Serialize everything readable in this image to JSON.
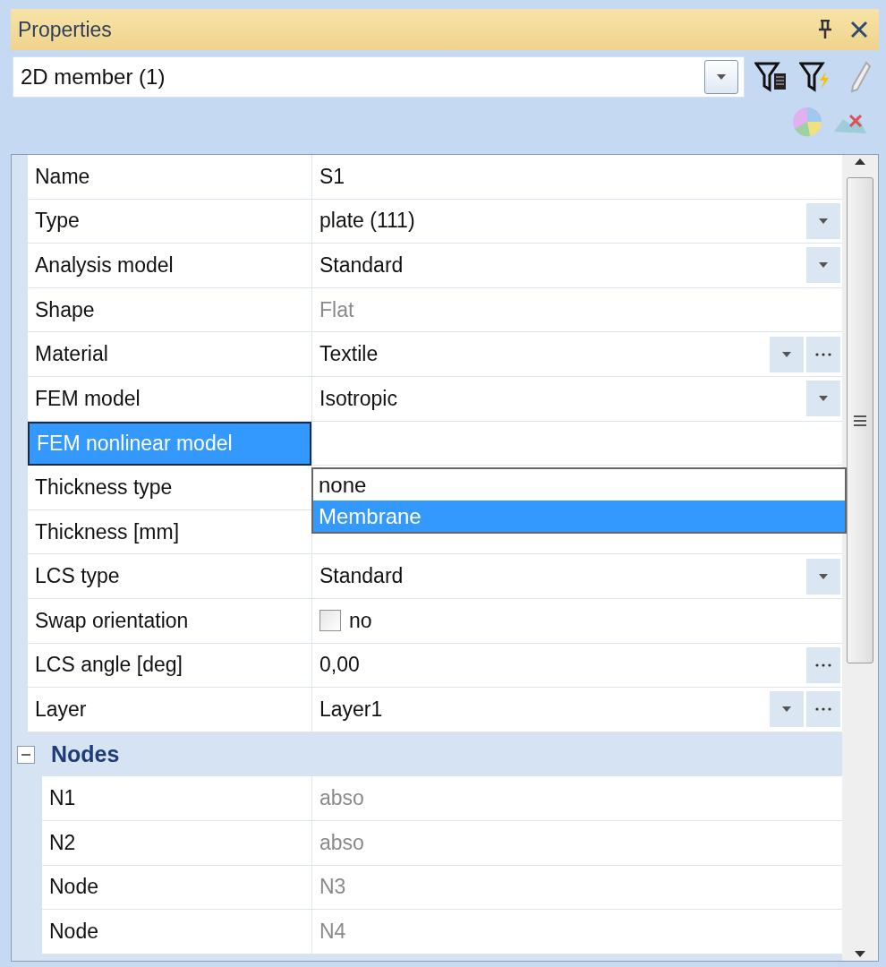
{
  "panel": {
    "title": "Properties"
  },
  "selector": {
    "value": "2D member (1)"
  },
  "properties": [
    {
      "label": "Name",
      "value": "S1",
      "kind": "text",
      "disabled": false,
      "selected": false
    },
    {
      "label": "Type",
      "value": "plate (111)",
      "kind": "dropdown",
      "disabled": false,
      "selected": false
    },
    {
      "label": "Analysis model",
      "value": "Standard",
      "kind": "dropdown",
      "disabled": false,
      "selected": false
    },
    {
      "label": "Shape",
      "value": "Flat",
      "kind": "text",
      "disabled": true,
      "selected": false
    },
    {
      "label": "Material",
      "value": "Textile",
      "kind": "combo",
      "disabled": false,
      "selected": false
    },
    {
      "label": "FEM model",
      "value": "Isotropic",
      "kind": "dropdown",
      "disabled": false,
      "selected": false
    },
    {
      "label": "FEM nonlinear model",
      "kind": "open",
      "selected": true,
      "options": [
        {
          "label": "none",
          "selected": false
        },
        {
          "label": "Membrane",
          "selected": true
        }
      ]
    },
    {
      "label": "Thickness type",
      "kind": "text",
      "selected": false
    },
    {
      "label": "Thickness [mm]",
      "kind": "text",
      "selected": false
    },
    {
      "label": "LCS type",
      "value": "Standard",
      "kind": "dropdown",
      "disabled": false,
      "selected": false
    },
    {
      "label": "Swap orientation",
      "value": "no",
      "kind": "checkbox",
      "checked": false,
      "disabled": false,
      "selected": false
    },
    {
      "label": "LCS angle [deg]",
      "value": "0,00",
      "kind": "browse",
      "disabled": false,
      "selected": false
    },
    {
      "label": "Layer",
      "value": "Layer1",
      "kind": "combo",
      "disabled": false,
      "selected": false
    }
  ],
  "group": {
    "title": "Nodes",
    "expanded": true,
    "rows": [
      {
        "label": "N1",
        "value": "abso",
        "disabled": true
      },
      {
        "label": "N2",
        "value": "abso",
        "disabled": true
      },
      {
        "label": "Node",
        "value": "N3",
        "disabled": true
      },
      {
        "label": "Node",
        "value": "N4",
        "disabled": true
      }
    ]
  }
}
